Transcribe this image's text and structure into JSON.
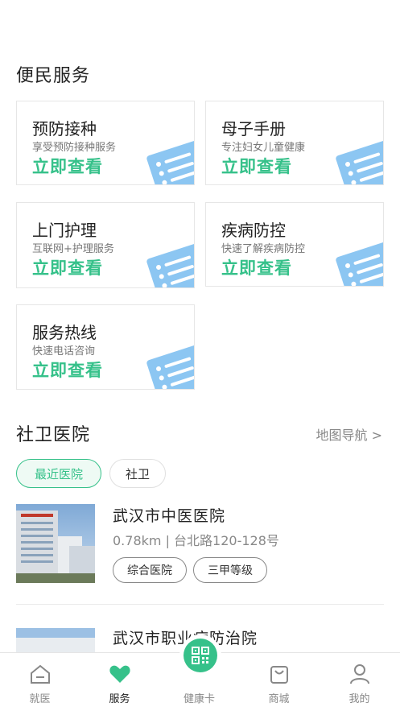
{
  "services": {
    "title": "便民服务",
    "cards": [
      {
        "title": "预防接种",
        "subtitle": "享受预防接种服务",
        "action": "立即查看"
      },
      {
        "title": "母子手册",
        "subtitle": "专注妇女儿童健康",
        "action": "立即查看"
      },
      {
        "title": "上门护理",
        "subtitle": "互联网+护理服务",
        "action": "立即查看"
      },
      {
        "title": "疾病防控",
        "subtitle": "快速了解疾病防控",
        "action": "立即查看"
      },
      {
        "title": "服务热线",
        "subtitle": "快速电话咨询",
        "action": "立即查看"
      }
    ]
  },
  "hospitals": {
    "title": "社卫医院",
    "map_link": "地图导航 >",
    "filters": [
      {
        "label": "最近医院",
        "active": true
      },
      {
        "label": "社卫",
        "active": false
      }
    ],
    "items": [
      {
        "name": "武汉市中医医院",
        "meta": "0.78km | 台北路120-128号",
        "tags": [
          "综合医院",
          "三甲等级"
        ]
      },
      {
        "name": "武汉市职业病防治院"
      }
    ]
  },
  "tabbar": {
    "tabs": [
      {
        "label": "就医",
        "icon": "home-icon"
      },
      {
        "label": "服务",
        "icon": "heart-icon",
        "active": true
      },
      {
        "label": "健康卡",
        "icon": "qr-code-icon"
      },
      {
        "label": "商城",
        "icon": "shopping-bag-icon"
      },
      {
        "label": "我的",
        "icon": "user-icon"
      }
    ]
  },
  "colors": {
    "accent": "#36c18a",
    "doc_icon": "#8cc6f2"
  }
}
